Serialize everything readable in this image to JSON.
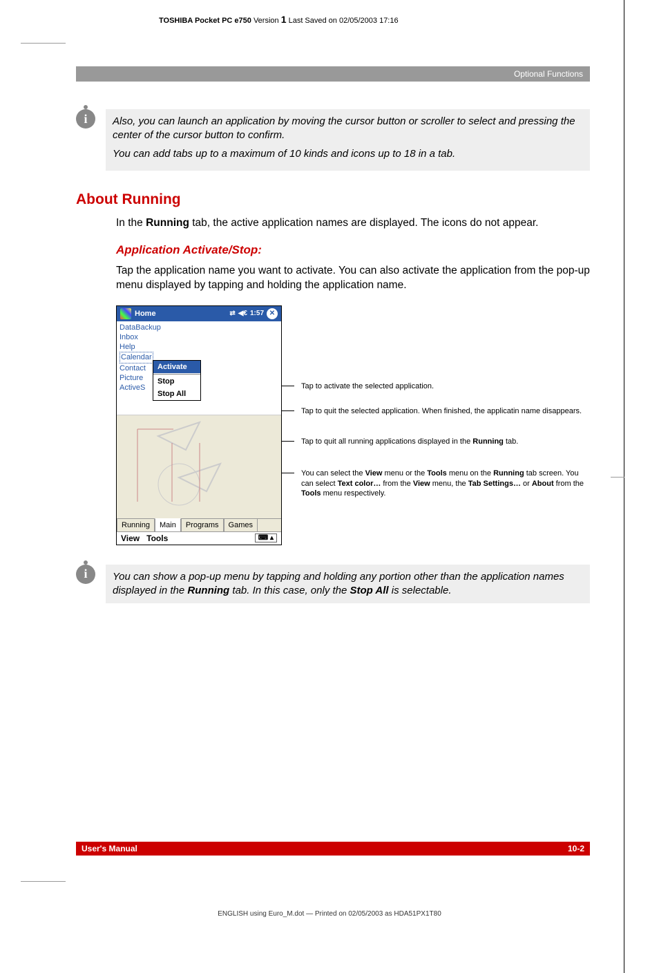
{
  "header": {
    "product": "TOSHIBA Pocket PC e750",
    "version_label": "Version",
    "version_num": "1",
    "save_info": "Last Saved on 02/05/2003 17:16"
  },
  "section_label": "Optional Functions",
  "info1": {
    "p1": "Also, you can launch an application by moving the cursor button or scroller to select and pressing the center of the cursor button to confirm.",
    "p2": "You can add tabs up to a maximum of 10 kinds and icons up to 18 in a tab."
  },
  "h1": "About Running",
  "body1_pre": "In the ",
  "body1_bold": "Running",
  "body1_post": " tab, the active application names are displayed. The icons do not appear.",
  "h2": "Application Activate/Stop:",
  "body2": "Tap the application name you want to activate. You can also activate the application from the pop-up menu displayed by tapping and holding the application name.",
  "device": {
    "title": "Home",
    "time": "1:57",
    "apps": [
      "DataBackup",
      "Inbox",
      "Help",
      "Calendar",
      "Contact",
      "Picture",
      "ActiveS"
    ],
    "popup": {
      "activate": "Activate",
      "stop": "Stop",
      "stopall": "Stop All"
    },
    "tabs": [
      "Running",
      "Main",
      "Programs",
      "Games"
    ],
    "menus": [
      "View",
      "Tools"
    ]
  },
  "callouts": {
    "c1": "Tap to activate the selected application.",
    "c2": "Tap to quit the selected application. When finished, the applicatin name disappears.",
    "c3_pre": "Tap to quit all running applications displayed in the ",
    "c3_b": "Running",
    "c3_post": " tab.",
    "c4_1": "You can select the ",
    "c4_b1": "View",
    "c4_2": " menu or the ",
    "c4_b2": "Tools",
    "c4_3": " menu on the ",
    "c4_b3": "Running",
    "c4_4": " tab screen. You can select ",
    "c4_b4": "Text color…",
    "c4_5": " from the ",
    "c4_b5": "View",
    "c4_6": " menu, the ",
    "c4_b6": "Tab Settings…",
    "c4_7": " or ",
    "c4_b7": "About",
    "c4_8": " from the ",
    "c4_b8": "Tools",
    "c4_9": " menu respectively."
  },
  "info2_1": "You can show a pop-up menu by tapping and holding any portion other than the application names displayed in the ",
  "info2_b1": "Running",
  "info2_2": " tab. In this case, only the ",
  "info2_b2": "Stop All",
  "info2_3": " is selectable.",
  "footer": {
    "left": "User's Manual",
    "right": "10-2"
  },
  "print_line": "ENGLISH using Euro_M.dot — Printed on 02/05/2003 as HDA51PX1T80"
}
